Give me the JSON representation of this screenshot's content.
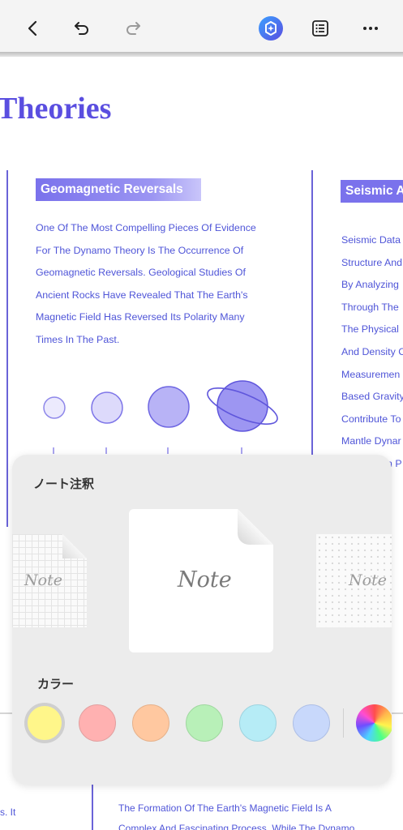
{
  "toolbar": {
    "back_icon": "chevron-left-icon",
    "undo_icon": "undo-icon",
    "redo_icon": "redo-icon",
    "ai_icon": "ai-assistant-icon",
    "outline_icon": "list-icon",
    "more_icon": "more-icon"
  },
  "document": {
    "heading": "Theories",
    "col1": {
      "tag": "Geomagnetic Reversals",
      "lines": [
        "One Of The Most Compelling Pieces Of Evidence",
        "For The Dynamo Theory Is The Occurrence Of",
        "Geomagnetic Reversals. Geological Studies Of",
        "Ancient Rocks Have Revealed That The Earth's",
        "Magnetic Field Has Reversed Its Polarity Many",
        "Times In The Past."
      ]
    },
    "col2": {
      "tag": "Seismic A",
      "lines": [
        "Seismic Data",
        "Structure And",
        "By Analyzing",
        "Through The",
        "The Physical",
        "And Density C",
        "Measuremen",
        "Based Gravity",
        "Contribute To",
        "Mantle Dynar",
        "n P"
      ]
    },
    "bottom": {
      "left_fragment": "s. It",
      "line1": "The Formation Of The Earth's Magnetic Field Is A",
      "line2": "Complex And Fascinating Process. While The Dynamo"
    }
  },
  "sheet": {
    "title": "ノート注釈",
    "note_label": "Note",
    "color_label": "カラー",
    "colors": [
      {
        "name": "yellow",
        "hex": "#fff68a",
        "selected": true
      },
      {
        "name": "red",
        "hex": "#ffb1b1"
      },
      {
        "name": "orange",
        "hex": "#ffc8a0"
      },
      {
        "name": "green",
        "hex": "#b8f0b8"
      },
      {
        "name": "cyan",
        "hex": "#b6ecf6"
      },
      {
        "name": "blue",
        "hex": "#c8d8fb"
      },
      {
        "name": "custom",
        "hex": "gradient"
      }
    ]
  },
  "accent": "#5a4ee0"
}
